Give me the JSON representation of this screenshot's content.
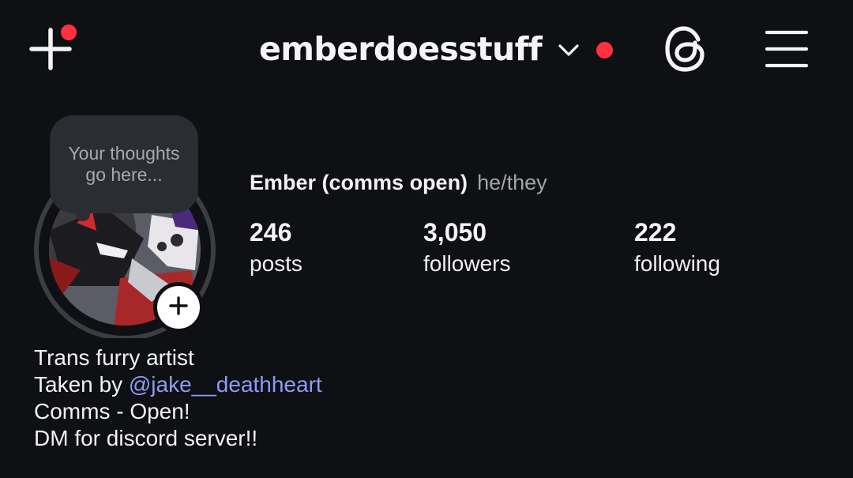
{
  "header": {
    "username": "emberdoesstuff",
    "create_icon": "plus-icon",
    "switch_icon": "chevron-down-icon",
    "threads_icon": "threads-icon",
    "menu_icon": "hamburger-menu-icon",
    "notification_color": "#ff3040"
  },
  "profile": {
    "thought_placeholder": "Your thoughts go here...",
    "display_name": "Ember (comms open)",
    "pronouns": "he/they",
    "add_story_icon": "plus-icon",
    "stats": {
      "posts": {
        "count": "246",
        "label": "posts"
      },
      "followers": {
        "count": "3,050",
        "label": "followers"
      },
      "following": {
        "count": "222",
        "label": "following"
      }
    },
    "bio": {
      "line1": "Trans furry artist",
      "line2_prefix": "Taken by ",
      "line2_mention": "@jake__deathheart",
      "line3": "Comms - Open!",
      "line4": "DM for discord server!!"
    }
  },
  "colors": {
    "background": "#0f1014",
    "mention": "#8f9bf5",
    "secondary_text": "#a2a4a9",
    "bubble": "#2b2d32"
  }
}
